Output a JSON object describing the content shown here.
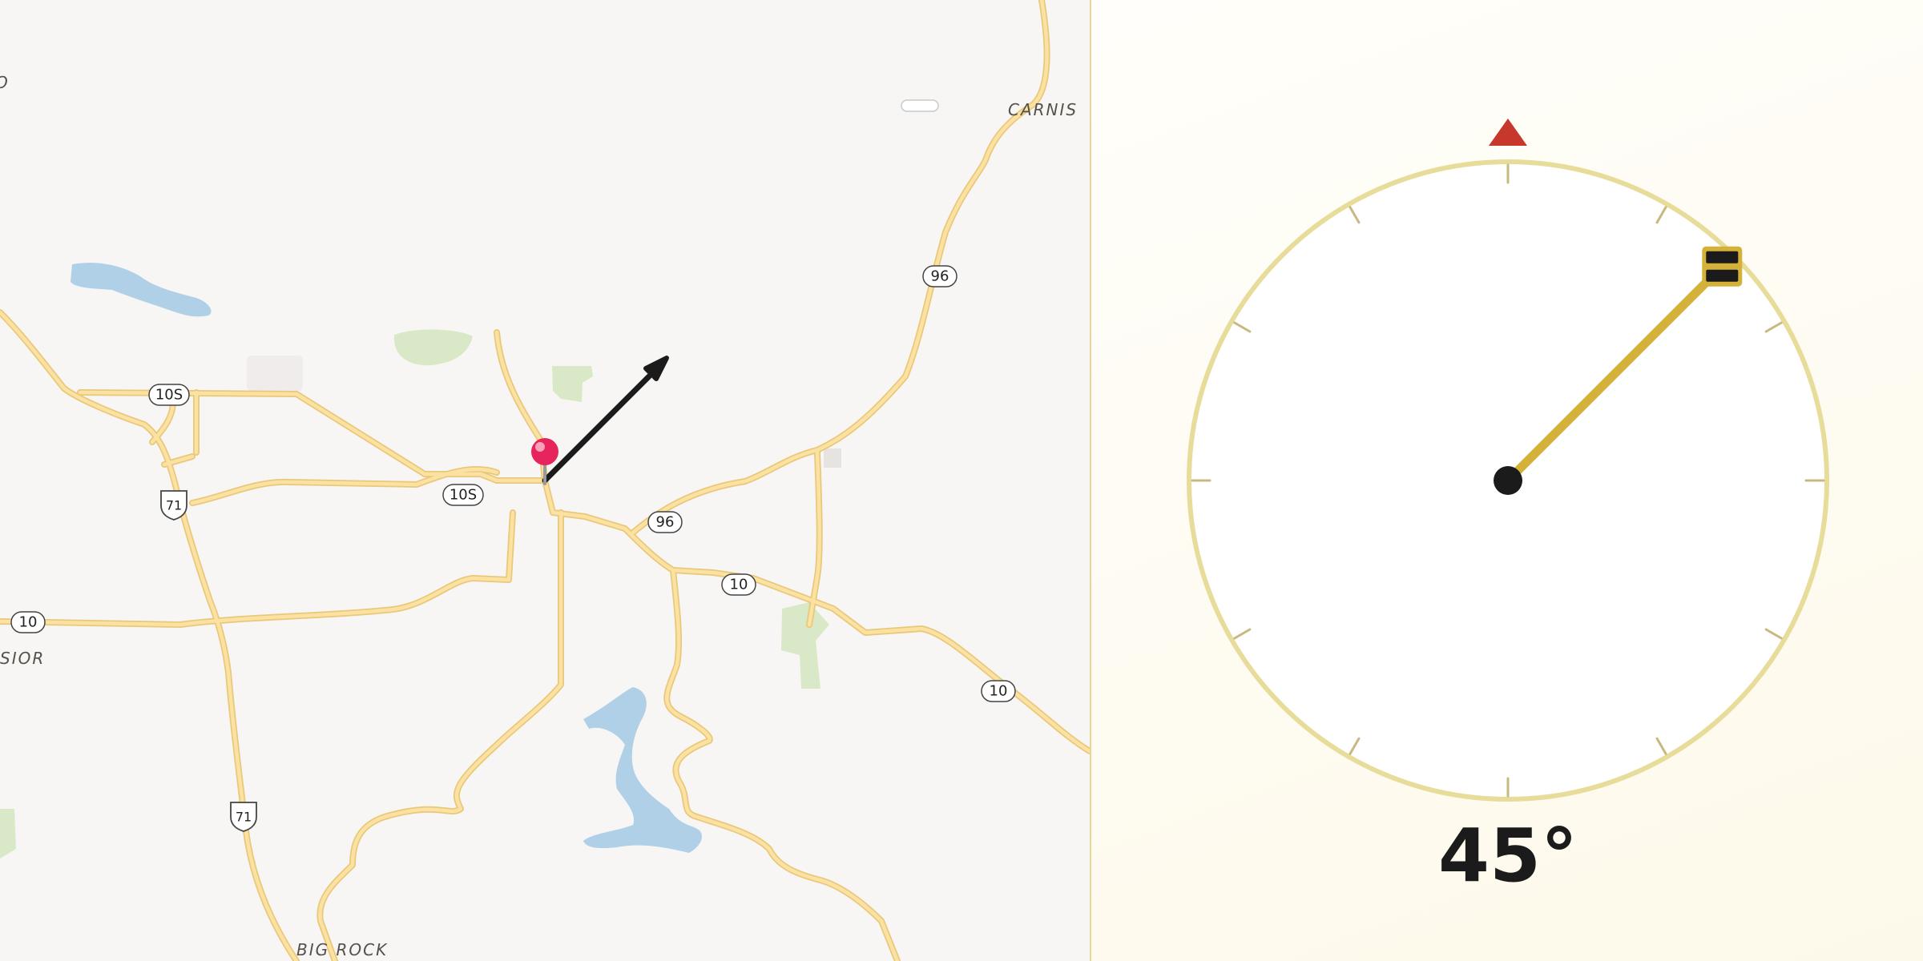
{
  "map": {
    "towns": {
      "carnis": "CARNIS",
      "big_rock": "BIG ROCK",
      "excelsior_partial": "SIOR",
      "west_partial": "O"
    },
    "route_shields": {
      "r10s_a": "10S",
      "r10s_b": "10S",
      "r71_a": "71",
      "r71_b": "71",
      "r96_a": "96",
      "r96_b": "96",
      "r10_a": "10",
      "r10_b": "10",
      "r10_c": "10"
    },
    "colors": {
      "background": "#f8f6f4",
      "road": "#f6d98a",
      "water": "#afd0e6",
      "park": "#d9e9c8",
      "pin": "#e8245c",
      "heading_arrow": "#1b1b1b"
    }
  },
  "compass": {
    "heading_degrees": 45,
    "heading_label": "45°",
    "colors": {
      "dial_ring": "#e8dc9a",
      "tick": "#c9b880",
      "needle": "#d4b23a",
      "north_marker": "#c8372c",
      "hub": "#1b1b1b"
    }
  }
}
